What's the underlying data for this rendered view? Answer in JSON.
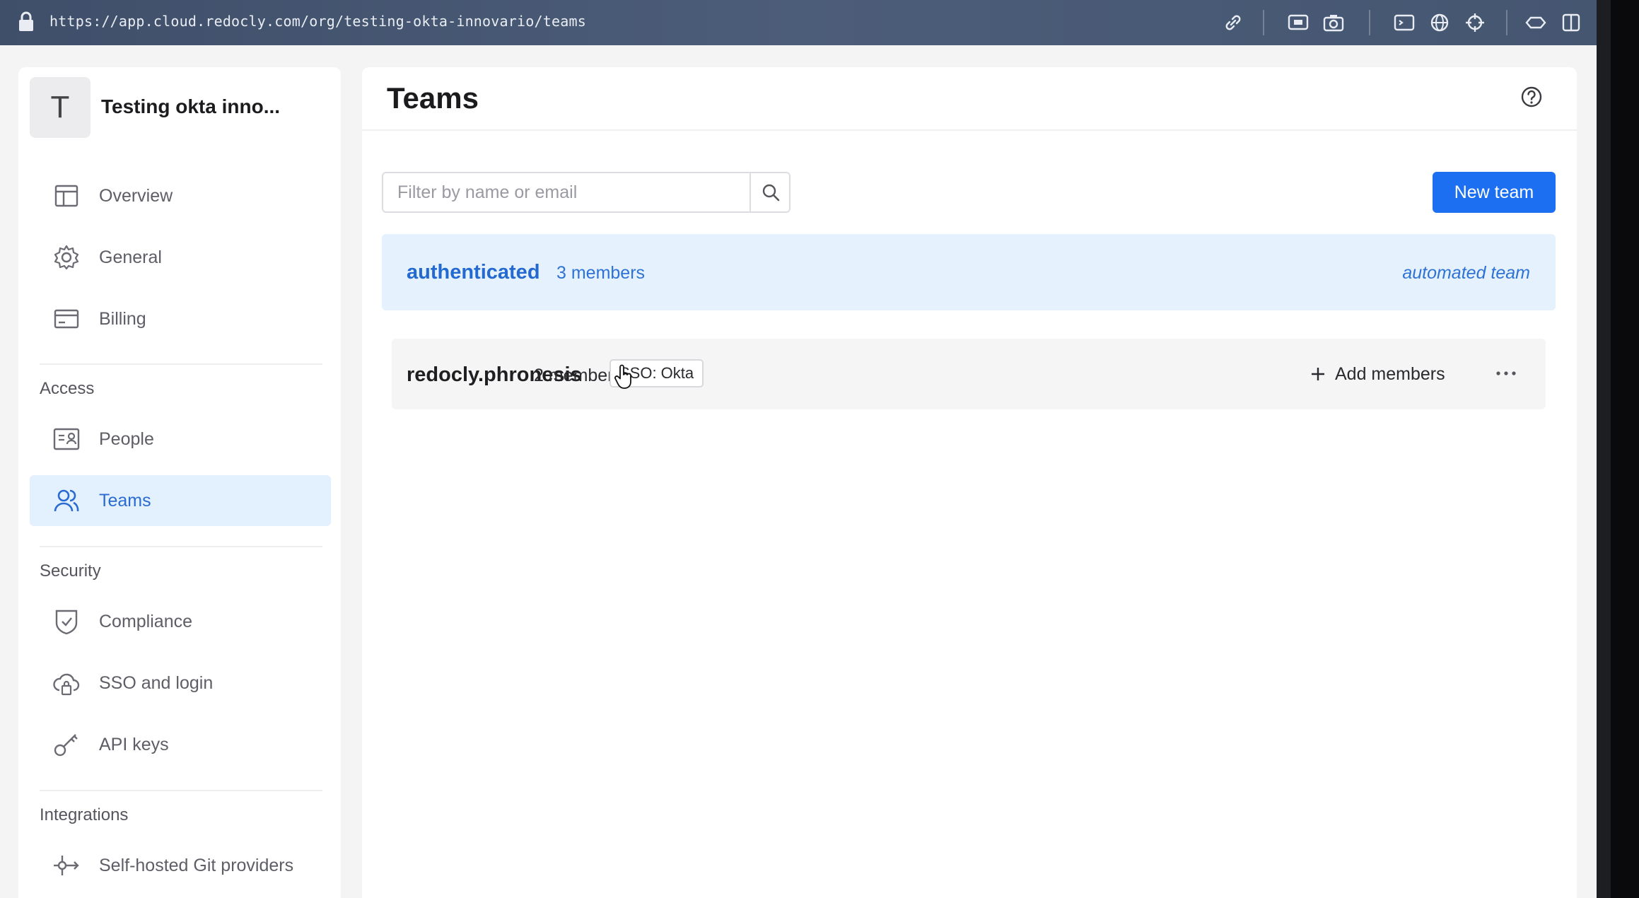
{
  "browser": {
    "url": "https://app.cloud.redocly.com/org/testing-okta-innovario/teams",
    "toolbar_icons": [
      "link-icon",
      "screen-capture-icon",
      "camera-icon",
      "terminal-icon",
      "globe-icon",
      "crosshair-icon",
      "extensions-icon",
      "split-view-icon"
    ]
  },
  "sidebar": {
    "org_initial": "T",
    "org_name": "Testing okta inno...",
    "items_main": [
      {
        "label": "Overview",
        "icon": "layout-icon"
      },
      {
        "label": "General",
        "icon": "gear-icon"
      },
      {
        "label": "Billing",
        "icon": "credit-card-icon"
      }
    ],
    "sections": {
      "access": {
        "label": "Access",
        "items": [
          {
            "label": "People",
            "icon": "id-card-icon"
          },
          {
            "label": "Teams",
            "icon": "users-icon",
            "active": true
          }
        ]
      },
      "security": {
        "label": "Security",
        "items": [
          {
            "label": "Compliance",
            "icon": "shield-check-icon"
          },
          {
            "label": "SSO and login",
            "icon": "cloud-lock-icon"
          },
          {
            "label": "API keys",
            "icon": "key-icon"
          }
        ]
      },
      "integrations": {
        "label": "Integrations",
        "items": [
          {
            "label": "Self-hosted Git providers",
            "icon": "git-commit-icon"
          }
        ]
      }
    }
  },
  "main": {
    "title": "Teams",
    "search": {
      "placeholder": "Filter by name or email",
      "value": ""
    },
    "new_team_label": "New team",
    "teams": [
      {
        "name": "authenticated",
        "members": "3 members",
        "tag": "automated team"
      },
      {
        "name": "redocly.phronesis",
        "members": "2 members",
        "badge": "SSO: Okta",
        "action": "Add members",
        "more": "···"
      }
    ]
  },
  "colors": {
    "accent": "#1d6ff2",
    "active_nav_bg": "#e3f0fd",
    "automated_card_bg": "#e5f2fd"
  }
}
